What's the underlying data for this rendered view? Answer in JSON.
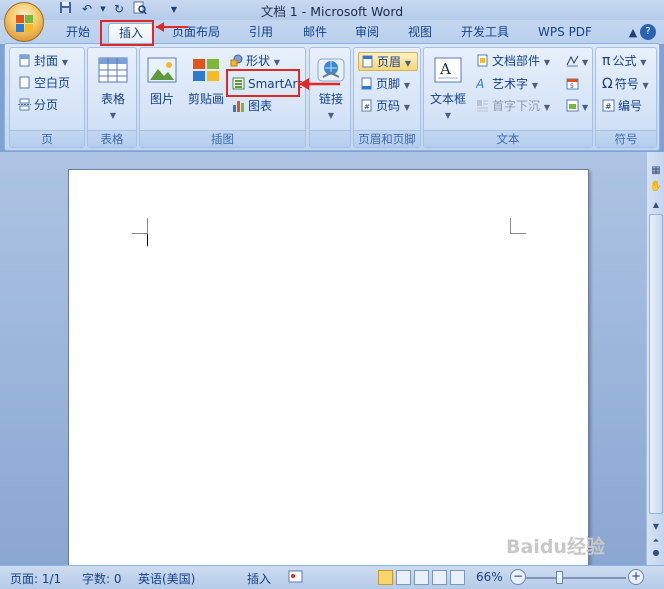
{
  "window": {
    "title": "文档 1 - Microsoft Word"
  },
  "quick_access": {
    "save_icon": "save-icon",
    "undo_icon": "undo-icon",
    "redo_icon": "redo-icon",
    "print_preview_icon": "print-preview-icon",
    "customize_icon": "chevron-down-icon"
  },
  "tabs": [
    {
      "label": "开始"
    },
    {
      "label": "插入",
      "active": true
    },
    {
      "label": "页面布局"
    },
    {
      "label": "引用"
    },
    {
      "label": "邮件"
    },
    {
      "label": "审阅"
    },
    {
      "label": "视图"
    },
    {
      "label": "开发工具"
    },
    {
      "label": "WPS PDF"
    }
  ],
  "ribbon": {
    "groups": {
      "pages": {
        "label": "页",
        "cover": "封面",
        "blank_page": "空白页",
        "page_break": "分页"
      },
      "table": {
        "label": "表格",
        "table": "表格"
      },
      "illustrations": {
        "label": "插图",
        "picture": "图片",
        "clipart": "剪贴画",
        "shapes": "形状",
        "smartart": "SmartArt",
        "chart": "图表"
      },
      "links": {
        "label": "",
        "link": "链接"
      },
      "header_footer": {
        "label": "页眉和页脚",
        "header": "页眉",
        "footer": "页脚",
        "page_number": "页码"
      },
      "text": {
        "label": "文本",
        "textbox": "文本框",
        "quick_parts": "文档部件",
        "wordart": "艺术字",
        "drop_cap": "首字下沉"
      },
      "symbols": {
        "label": "符号",
        "equation": "公式",
        "symbol": "符号",
        "numbering": "编号"
      }
    }
  },
  "statusbar": {
    "page": "页面: 1/1",
    "words": "字数: 0",
    "language": "英语(美国)",
    "mode": "插入",
    "zoom": "66%",
    "zoom_level": 0.66
  },
  "watermark": {
    "text": "Baidu经验"
  },
  "colors": {
    "highlight": "#e02826",
    "ribbon": "#dbe7f6",
    "text": "#15428b"
  }
}
